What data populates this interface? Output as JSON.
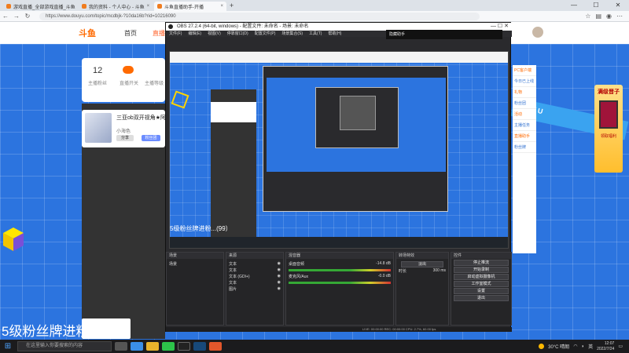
{
  "browser": {
    "tabs": [
      {
        "title": "游戏直播_全部游戏直播_斗鱼游",
        "close": "×"
      },
      {
        "title": "我的资料 - 个人中心 - 斗鱼",
        "close": "×"
      },
      {
        "title": "斗鱼直播助手-开播",
        "close": "×"
      }
    ],
    "new_tab": "+",
    "url": "https://www.douyu.com/topic/mcdbjk-?10da16b?rid=10216090",
    "window_controls": [
      "—",
      "☐",
      "✕"
    ]
  },
  "site": {
    "logo": "斗鱼",
    "nav": [
      "首页",
      "直播"
    ],
    "profile": {
      "fans_count": "12",
      "fans_label": "主播粉丝",
      "stat_a_label": "直播开关",
      "stat_b_label": "主播等级"
    },
    "live": {
      "title": "三亚ob双开视角★阿",
      "subtitle": "小海色",
      "btn1": "分享",
      "btn2": "粉丝团"
    },
    "right_items": [
      "PC客户端",
      "今日已上线",
      "礼物",
      "粉丝团",
      "活动",
      "主播任务",
      "直播助手",
      "粉丝牌"
    ],
    "band_text": "YU",
    "ad": {
      "title": "满级晋子",
      "sub": "领取福利"
    },
    "bottom_text": "5级粉丝牌进粉...(99）"
  },
  "obs": {
    "title": "OBS 27.2.4 (64-bit, windows) - 配置文件: 未命名 - 场景: 未命名",
    "menu": [
      "文件(F)",
      "编辑(E)",
      "视图(V)",
      "停靠窗口(D)",
      "配置文件(P)",
      "场景集合(S)",
      "工具(T)",
      "帮助(H)"
    ],
    "tooltip": "隐藏助手",
    "docks": {
      "scenes": {
        "title": "场景",
        "items": [
          "场景"
        ]
      },
      "sources": {
        "title": "来源",
        "items": [
          "文本",
          "文本",
          "文本 (GDI+)",
          "文本",
          "图片"
        ]
      },
      "mixer": {
        "title": "混音器",
        "tracks": [
          {
            "name": "桌面音频",
            "db": "-14.8 dB"
          },
          {
            "name": "麦克风/Aux",
            "db": "-0.0 dB"
          }
        ]
      },
      "transitions": {
        "title": "转场特效",
        "type": "淡出",
        "duration_label": "时长",
        "duration": "300 ms"
      },
      "controls": {
        "title": "控件",
        "buttons": [
          "停止推流",
          "开始录制",
          "启动虚拟摄像机",
          "工作室模式",
          "设置",
          "退出"
        ]
      }
    },
    "status": "LIVE: 00:00:00  REC: 00:00:00  CPU: 2.7%, 60.00 fps"
  },
  "taskbar": {
    "search_placeholder": "在这里输入你要搜索的内容",
    "temp": "30°C 晴朗",
    "time": "12:07",
    "date": "2022/7/24",
    "lang": "英"
  }
}
